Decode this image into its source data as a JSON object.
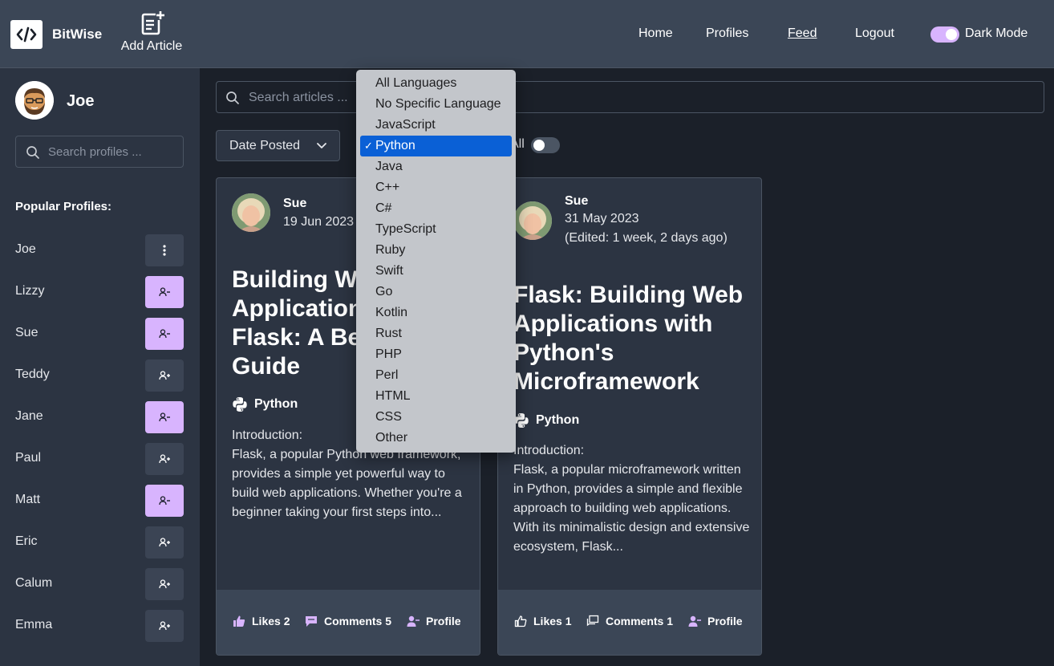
{
  "topnav": {
    "brand": "BitWise",
    "add_article": "Add Article",
    "links": [
      "Home",
      "Profiles",
      "Feed",
      "Logout"
    ],
    "active_link": "Feed",
    "dark_mode_label": "Dark Mode",
    "dark_mode_on": true,
    "accent": "#d8b4fe"
  },
  "sidebar": {
    "user_name": "Joe",
    "search_placeholder": "Search profiles ...",
    "heading": "Popular Profiles:",
    "profiles": [
      {
        "name": "Joe",
        "action": "more"
      },
      {
        "name": "Lizzy",
        "action": "unfollow"
      },
      {
        "name": "Sue",
        "action": "unfollow"
      },
      {
        "name": "Teddy",
        "action": "follow"
      },
      {
        "name": "Jane",
        "action": "unfollow"
      },
      {
        "name": "Paul",
        "action": "follow"
      },
      {
        "name": "Matt",
        "action": "unfollow"
      },
      {
        "name": "Eric",
        "action": "follow"
      },
      {
        "name": "Calum",
        "action": "follow"
      },
      {
        "name": "Emma",
        "action": "follow"
      }
    ]
  },
  "main": {
    "search_placeholder": "Search articles ...",
    "sort_value": "Date Posted",
    "all_label": "All",
    "all_toggle_on": false
  },
  "language_dropdown": {
    "options": [
      "All Languages",
      "No Specific Language",
      "JavaScript",
      "Python",
      "Java",
      "C++",
      "C#",
      "TypeScript",
      "Ruby",
      "Swift",
      "Go",
      "Kotlin",
      "Rust",
      "PHP",
      "Perl",
      "HTML",
      "CSS",
      "Other"
    ],
    "selected": "Python",
    "check": "✓"
  },
  "articles": [
    {
      "author": "Sue",
      "date": "19 Jun 2023",
      "edited": "",
      "title": "Building Web Applications with Flask: A Beginner's Guide",
      "language": "Python",
      "excerpt_intro": "Introduction:",
      "excerpt": "Flask, a popular Python web framework, provides a simple yet powerful way to build web applications. Whether you're a beginner taking your first steps into...",
      "likes": "Likes 2",
      "comments": "Comments 5",
      "profile": "Profile",
      "liked": true,
      "commented": true
    },
    {
      "author": "Sue",
      "date": "31 May 2023",
      "edited": "(Edited: 1 week, 2 days ago)",
      "title": "Flask: Building Web Applications with Python's Microframework",
      "language": "Python",
      "excerpt_intro": "Introduction:",
      "excerpt": "Flask, a popular microframework written in Python, provides a simple and flexible approach to building web applications. With its minimalistic design and extensive ecosystem, Flask...",
      "likes": "Likes 1",
      "comments": "Comments 1",
      "profile": "Profile",
      "liked": false,
      "commented": false
    }
  ]
}
